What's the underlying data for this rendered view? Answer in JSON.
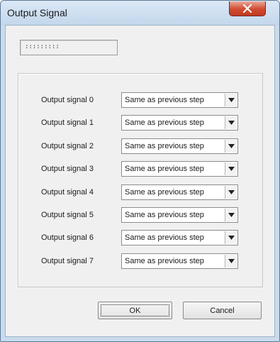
{
  "window": {
    "title": "Output Signal",
    "close_icon": "close-x-icon"
  },
  "display_field": {
    "value": ":::::::::"
  },
  "signals": [
    {
      "label": "Output signal 0",
      "value": "Same as previous step"
    },
    {
      "label": "Output signal 1",
      "value": "Same as previous step"
    },
    {
      "label": "Output signal 2",
      "value": "Same as previous step"
    },
    {
      "label": "Output signal 3",
      "value": "Same as previous step"
    },
    {
      "label": "Output signal 4",
      "value": "Same as previous step"
    },
    {
      "label": "Output signal 5",
      "value": "Same as previous step"
    },
    {
      "label": "Output signal 6",
      "value": "Same as previous step"
    },
    {
      "label": "Output signal 7",
      "value": "Same as previous step"
    }
  ],
  "buttons": {
    "ok_label": "OK",
    "cancel_label": "Cancel"
  },
  "colors": {
    "titlebar": "#c9dcef",
    "close_button": "#cf4b31",
    "client_bg": "#f0f0f0"
  }
}
